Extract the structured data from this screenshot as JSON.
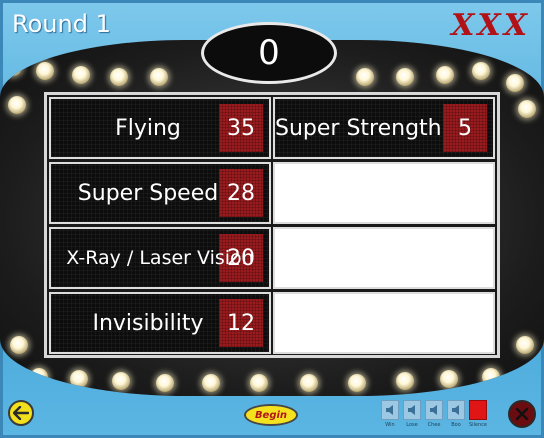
{
  "round": {
    "title": "Round 1"
  },
  "strikes": {
    "text": "XXX"
  },
  "score": {
    "value": "0"
  },
  "answers": {
    "left": [
      {
        "label": "Flying",
        "points": "35"
      },
      {
        "label": "Super Speed",
        "points": "28"
      },
      {
        "label": "X-Ray / Laser Vision",
        "points": "20"
      },
      {
        "label": "Invisibility",
        "points": "12"
      }
    ],
    "right": [
      {
        "label": "Super Strength",
        "points": "5"
      },
      {
        "label": "",
        "points": ""
      },
      {
        "label": "",
        "points": ""
      },
      {
        "label": "",
        "points": ""
      }
    ]
  },
  "controls": {
    "back_icon": "arrow-left-icon",
    "begin_label": "Begin",
    "sounds": [
      {
        "caption": "Win",
        "color": "#9cc8e4"
      },
      {
        "caption": "Lose",
        "color": "#9cc8e4"
      },
      {
        "caption": "Chee",
        "color": "#9cc8e4"
      },
      {
        "caption": "Boo",
        "color": "#9cc8e4"
      },
      {
        "caption": "Silence",
        "color": "#e01616"
      }
    ],
    "stop_icon": "close-icon"
  },
  "colors": {
    "background": "#4aa8da",
    "board": "#1c1c1c",
    "points_box": "#9a1b1e",
    "strikes": "#b11217",
    "begin": "#f4e21f"
  }
}
